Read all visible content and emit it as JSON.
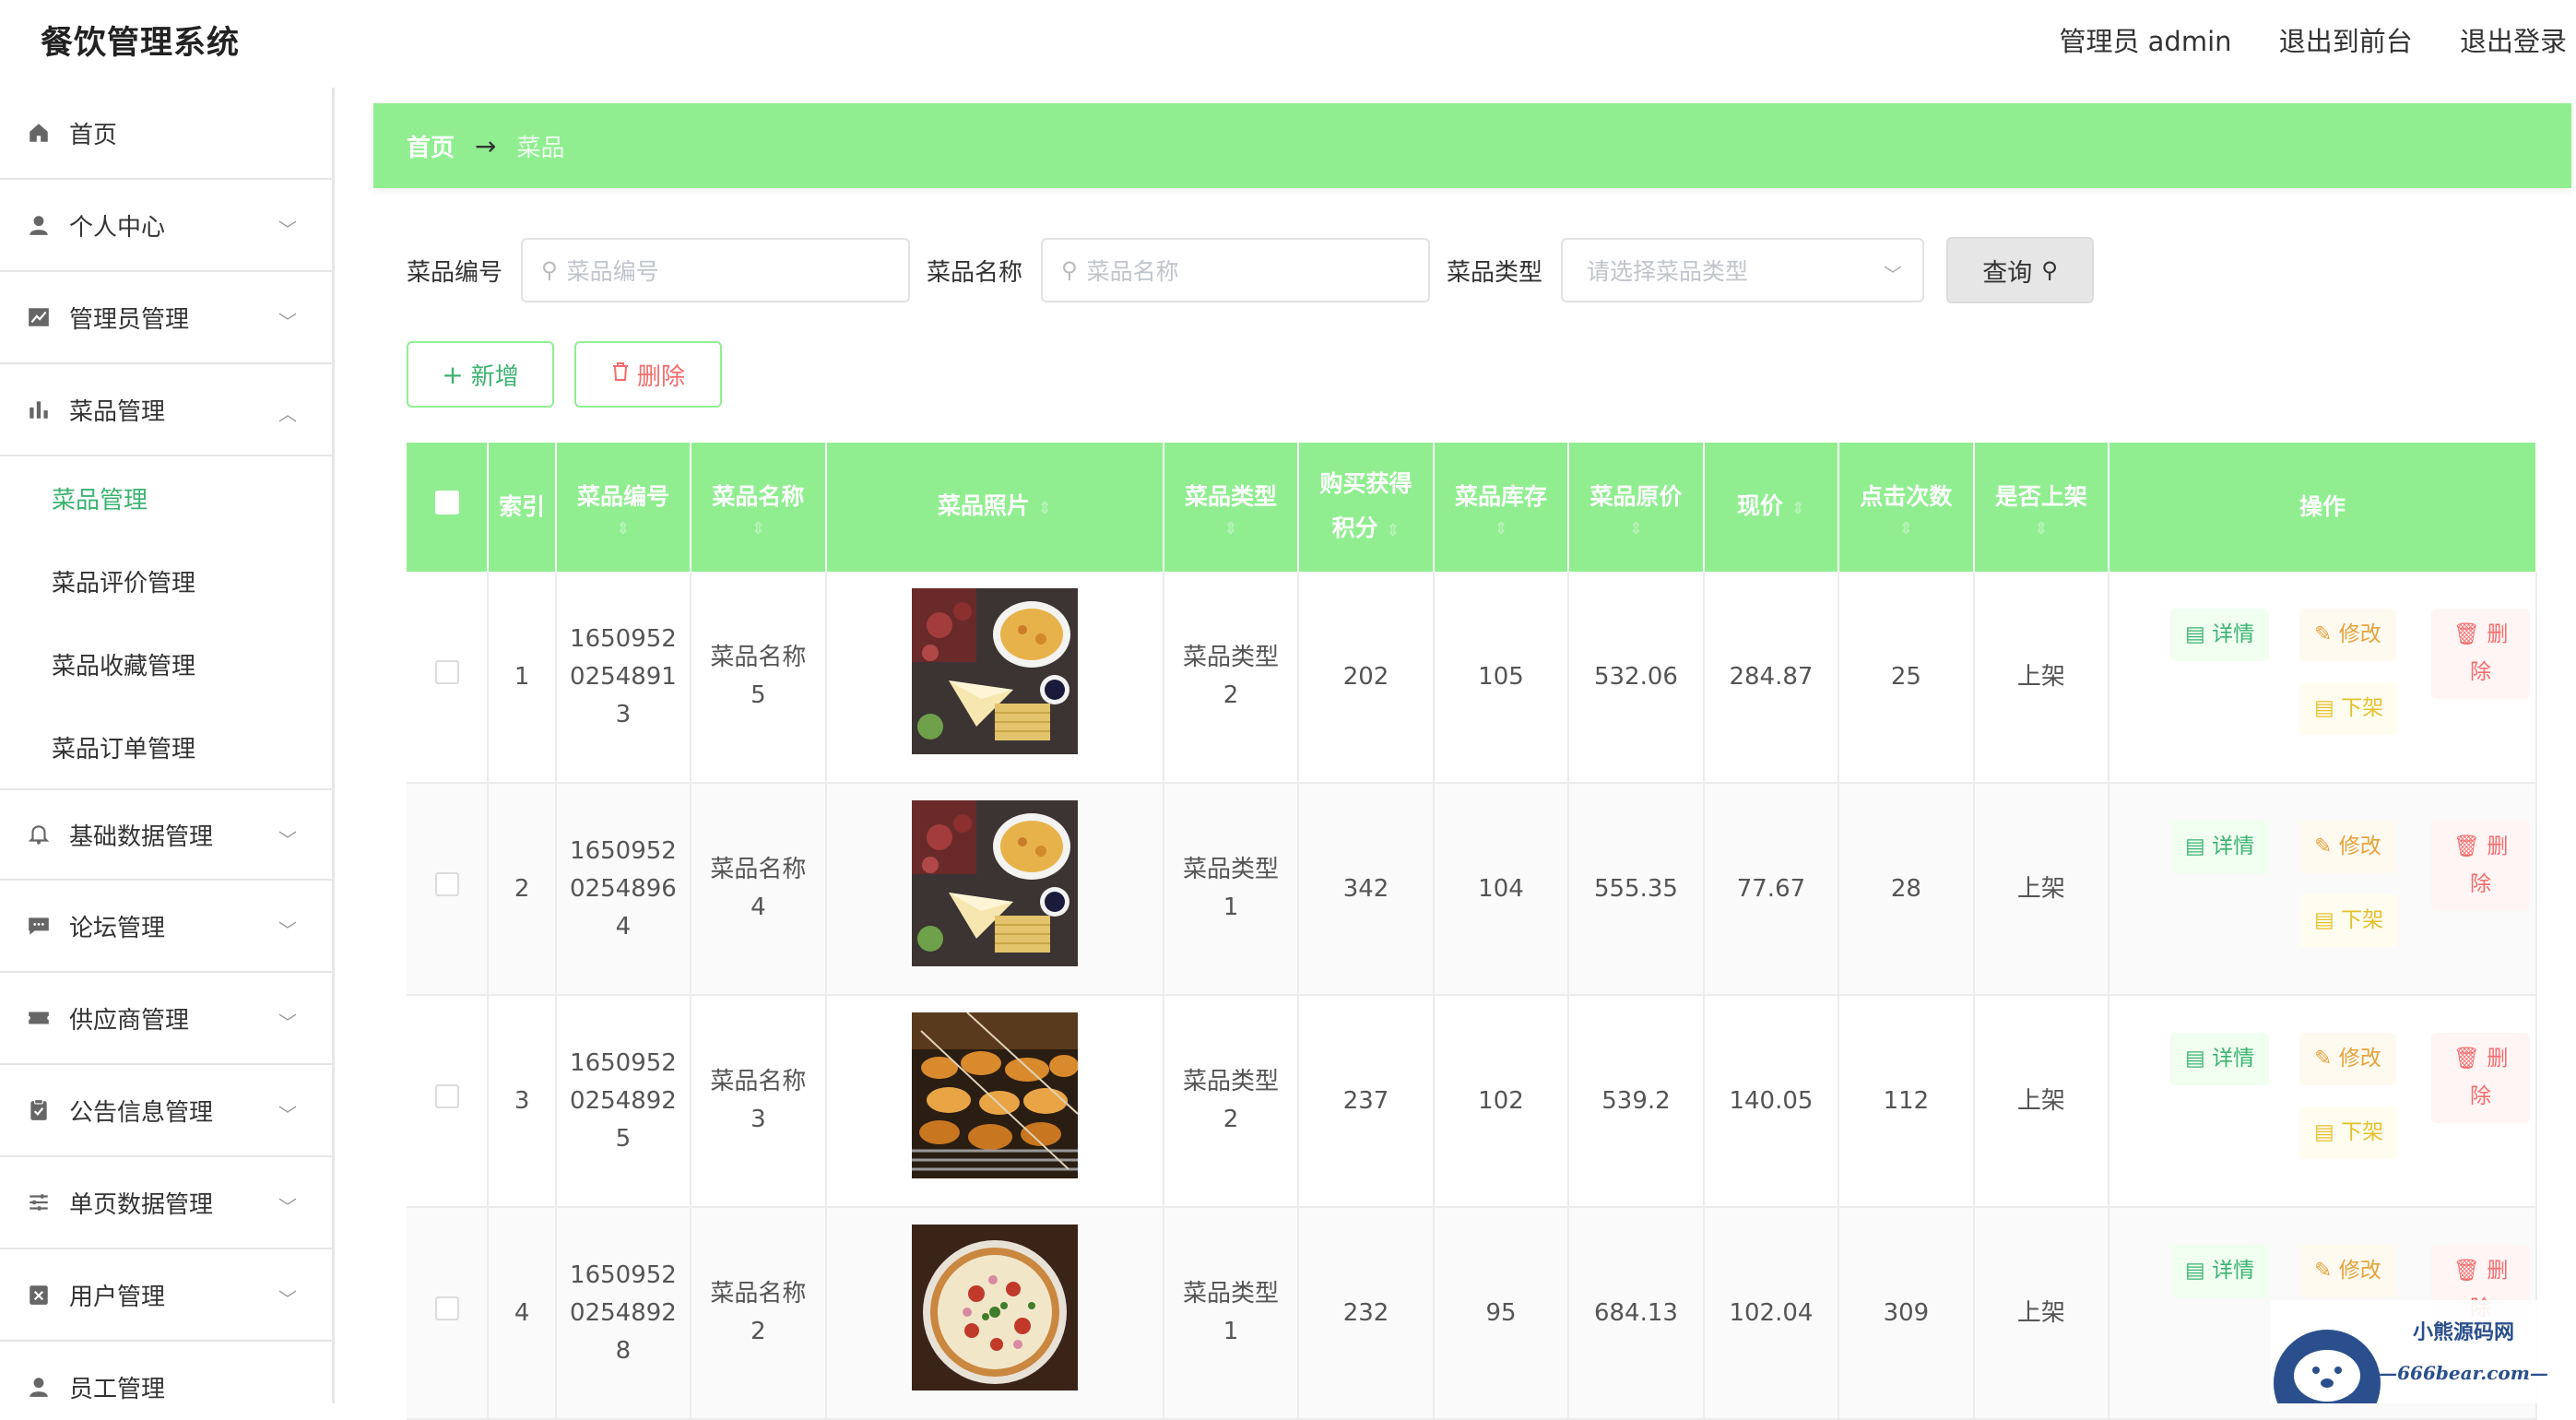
{
  "app": {
    "title": "餐饮管理系统"
  },
  "header": {
    "admin_label": "管理员 admin",
    "front_label": "退出到前台",
    "logout_label": "退出登录"
  },
  "sidebar": {
    "items": [
      {
        "label": "首页",
        "icon": "home-icon"
      },
      {
        "label": "个人中心",
        "icon": "user-icon"
      },
      {
        "label": "管理员管理",
        "icon": "chart-line-icon"
      },
      {
        "label": "菜品管理",
        "icon": "bar-chart-icon",
        "expanded": true,
        "children": [
          "菜品管理",
          "菜品评价管理",
          "菜品收藏管理",
          "菜品订单管理"
        ]
      },
      {
        "label": "基础数据管理",
        "icon": "bell-icon"
      },
      {
        "label": "论坛管理",
        "icon": "chat-icon"
      },
      {
        "label": "供应商管理",
        "icon": "ticket-icon"
      },
      {
        "label": "公告信息管理",
        "icon": "clipboard-check-icon"
      },
      {
        "label": "单页数据管理",
        "icon": "sliders-icon"
      },
      {
        "label": "用户管理",
        "icon": "cross-box-icon"
      },
      {
        "label": "员工管理",
        "icon": "user-icon"
      }
    ]
  },
  "breadcrumb": {
    "home": "首页",
    "arrow": "→",
    "current": "菜品"
  },
  "search": {
    "code_label": "菜品编号",
    "code_placeholder": "菜品编号",
    "name_label": "菜品名称",
    "name_placeholder": "菜品名称",
    "type_label": "菜品类型",
    "type_placeholder": "请选择菜品类型",
    "query_label": "查询"
  },
  "actions": {
    "add_label": "新增",
    "delete_label": "删除"
  },
  "table": {
    "headers": {
      "index": "索引",
      "code": "菜品编号",
      "name": "菜品名称",
      "photo": "菜品照片",
      "type": "菜品类型",
      "points_1": "购买获得",
      "points_2": "积分",
      "stock": "菜品库存",
      "orig": "菜品原价",
      "now": "现价",
      "clicks": "点击次数",
      "onshelf": "是否上架",
      "ops": "操作"
    },
    "op_labels": {
      "detail": "详情",
      "edit": "修改",
      "delete": "删除",
      "off": "下架"
    },
    "rows": [
      {
        "index": "1",
        "code_1": "1650952",
        "code_2": "0254891",
        "code_3": "3",
        "name_1": "菜品名称",
        "name_2": "5",
        "type_1": "菜品类型",
        "type_2": "2",
        "points": "202",
        "stock": "105",
        "orig": "532.06",
        "now": "284.87",
        "clicks": "25",
        "onshelf": "上架",
        "photo": "cheese-platter"
      },
      {
        "index": "2",
        "code_1": "1650952",
        "code_2": "0254896",
        "code_3": "4",
        "name_1": "菜品名称",
        "name_2": "4",
        "type_1": "菜品类型",
        "type_2": "1",
        "points": "342",
        "stock": "104",
        "orig": "555.35",
        "now": "77.67",
        "clicks": "28",
        "onshelf": "上架",
        "photo": "cheese-platter"
      },
      {
        "index": "3",
        "code_1": "1650952",
        "code_2": "0254892",
        "code_3": "5",
        "name_1": "菜品名称",
        "name_2": "3",
        "type_1": "菜品类型",
        "type_2": "2",
        "points": "237",
        "stock": "102",
        "orig": "539.2",
        "now": "140.05",
        "clicks": "112",
        "onshelf": "上架",
        "photo": "grilled-skewers"
      },
      {
        "index": "4",
        "code_1": "1650952",
        "code_2": "0254892",
        "code_3": "8",
        "name_1": "菜品名称",
        "name_2": "2",
        "type_1": "菜品类型",
        "type_2": "1",
        "points": "232",
        "stock": "95",
        "orig": "684.13",
        "now": "102.04",
        "clicks": "309",
        "onshelf": "上架",
        "photo": "pizza"
      }
    ]
  },
  "watermark": {
    "line1": "小熊源码网",
    "line2": "—666bear.com—"
  },
  "colors": {
    "accent": "#90ee90",
    "active": "#3cb371",
    "danger": "#f56c6c",
    "warning": "#e6a23c"
  }
}
